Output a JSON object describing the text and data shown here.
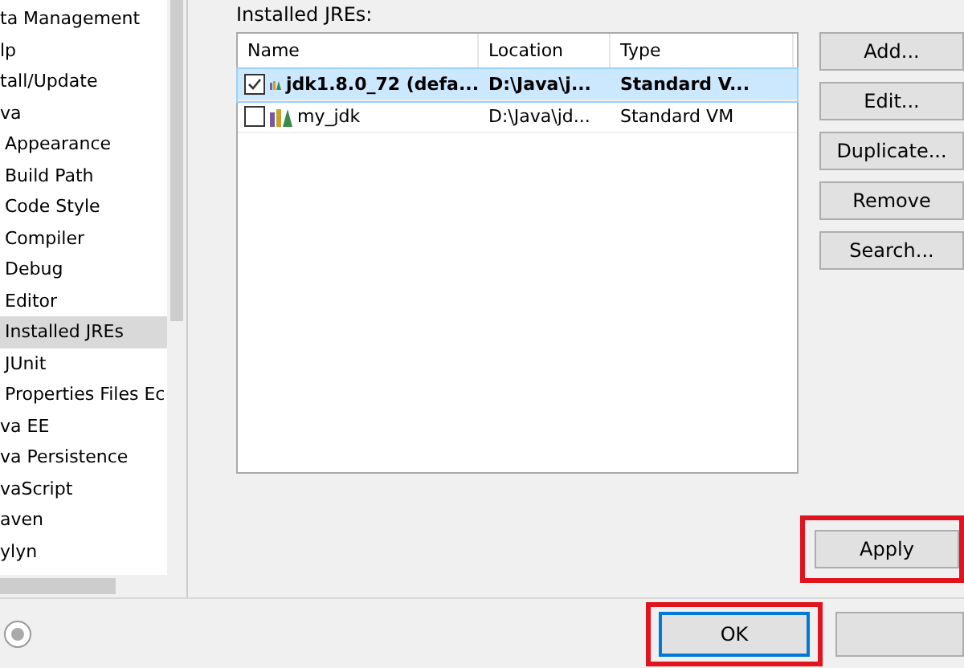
{
  "tree": {
    "items": [
      {
        "label": "ta Management"
      },
      {
        "label": "lp"
      },
      {
        "label": "tall/Update"
      },
      {
        "label": "va",
        "children": [
          {
            "label": "Appearance",
            "selected": false
          },
          {
            "label": "Build Path",
            "selected": false
          },
          {
            "label": "Code Style",
            "selected": false
          },
          {
            "label": "Compiler",
            "selected": false
          },
          {
            "label": "Debug",
            "selected": false
          },
          {
            "label": "Editor",
            "selected": false
          },
          {
            "label": "Installed JREs",
            "selected": true
          },
          {
            "label": "JUnit",
            "selected": false
          },
          {
            "label": "Properties Files Ec",
            "selected": false
          }
        ]
      },
      {
        "label": "va EE"
      },
      {
        "label": "va Persistence"
      },
      {
        "label": "vaScript"
      },
      {
        "label": "aven"
      },
      {
        "label": "ylyn"
      }
    ]
  },
  "jres": {
    "label": "Installed JREs:",
    "columns": [
      "Name",
      "Location",
      "Type"
    ],
    "rows": [
      {
        "name": "jdk1.8.0_72 (defa...",
        "location": "D:\\Java\\j...",
        "type": "Standard V...",
        "checked": true,
        "selected": true
      },
      {
        "name": "my_jdk",
        "location": "D:\\Java\\jd...",
        "type": "Standard VM",
        "checked": false,
        "selected": false
      }
    ]
  },
  "side_buttons": [
    "Add...",
    "Edit...",
    "Duplicate...",
    "Remove",
    "Search..."
  ],
  "apply_button": "Apply",
  "ok_button": "OK"
}
